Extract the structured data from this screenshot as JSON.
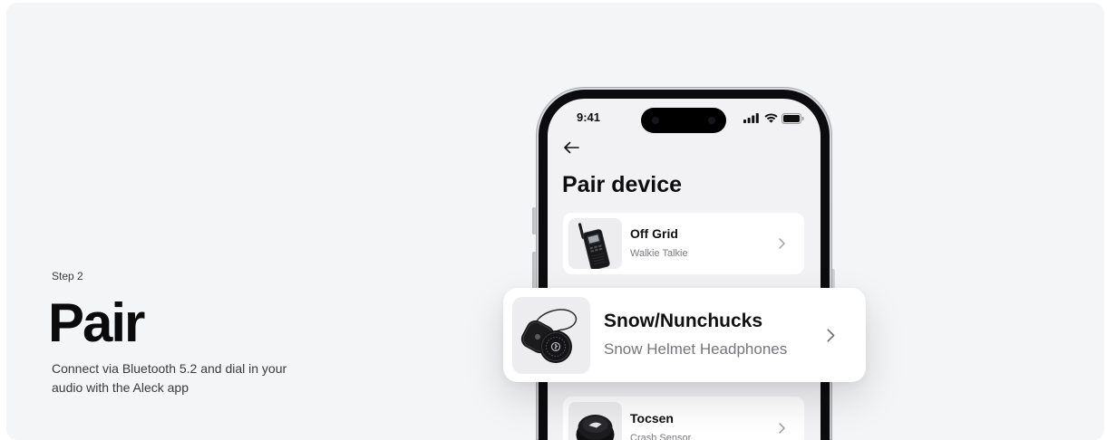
{
  "colors": {
    "page_background": "#ffffff",
    "section_background": "#f4f5f7",
    "screen_background": "#f2f2f5",
    "card_background": "#ffffff",
    "primary_text": "#111113",
    "body_text": "#3a3a3d",
    "secondary_text": "#7b7b80",
    "chevron": "#9b9ba1",
    "thumbnail_background": "#ededf0"
  },
  "section": {
    "step_label": "Step 2",
    "title": "Pair",
    "description": "Connect via Bluetooth 5.2 and dial in your audio with the Aleck app"
  },
  "phone": {
    "status_bar": {
      "time": "9:41",
      "icons": [
        "signal-icon",
        "wifi-icon",
        "battery-icon"
      ]
    },
    "back_icon": "arrow-left-icon",
    "screen_title": "Pair device",
    "devices": [
      {
        "name": "Off Grid",
        "subtitle": "Walkie Talkie",
        "chevron_icon": "chevron-right-icon"
      },
      {
        "name": "Tocsen",
        "subtitle": "Crash Sensor",
        "chevron_icon": "chevron-right-icon"
      }
    ]
  },
  "featured_device": {
    "name": "Snow/Nunchucks",
    "subtitle": "Snow Helmet Headphones",
    "chevron_icon": "chevron-right-icon"
  }
}
